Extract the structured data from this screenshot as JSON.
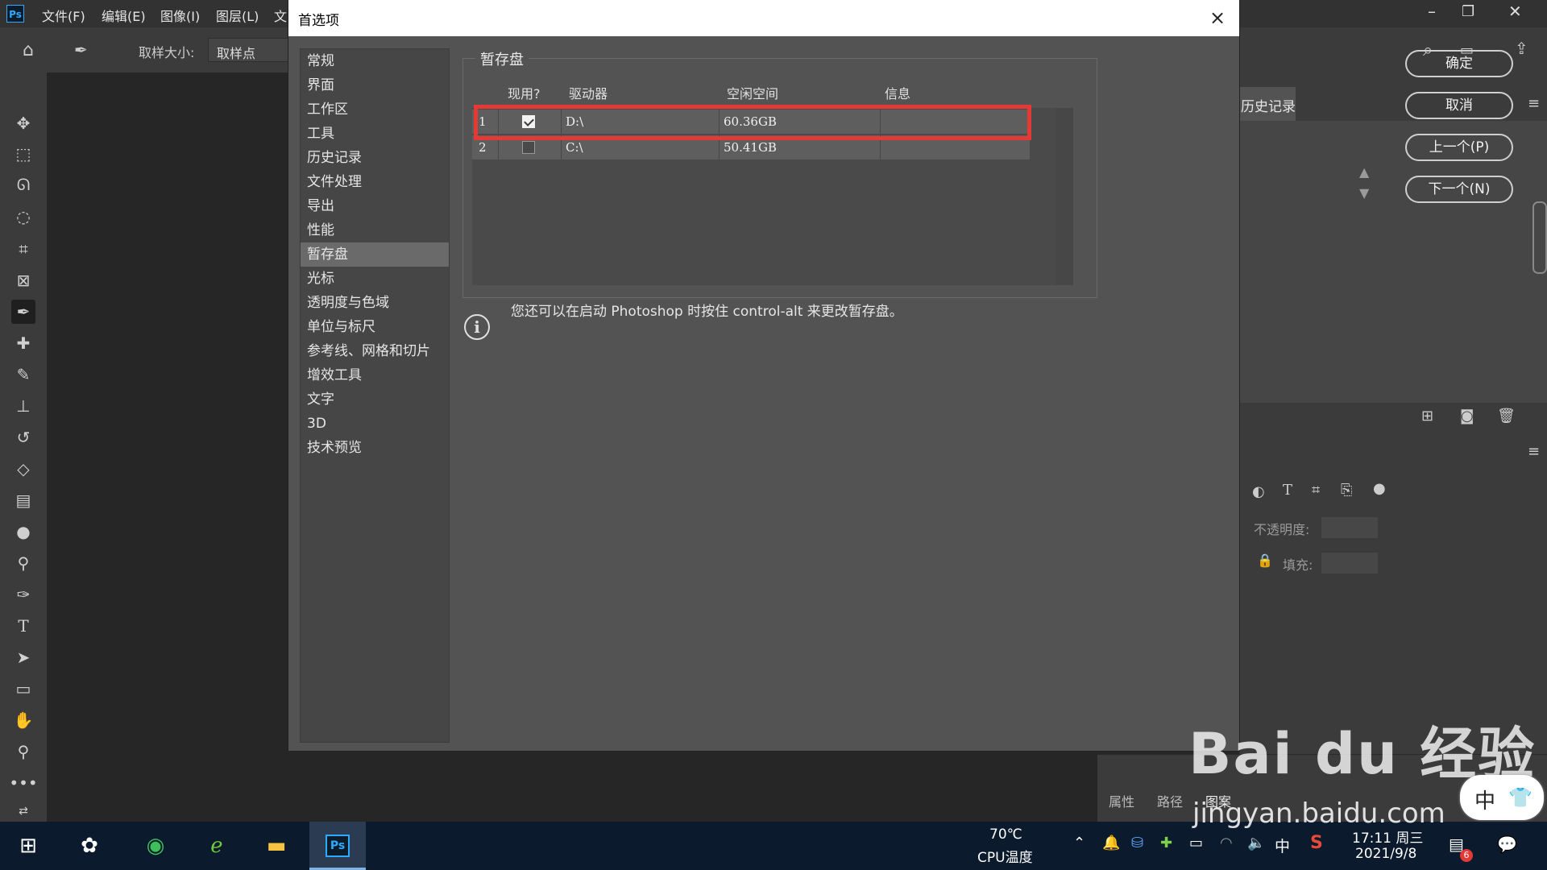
{
  "app": {
    "logo": "Ps",
    "menu": [
      "文件(F)",
      "编辑(E)",
      "图像(I)",
      "图层(L)",
      "文"
    ]
  },
  "options_bar": {
    "sample_size_label": "取样大小:",
    "sample_size_value": "取样点"
  },
  "right_panel": {
    "history_tab": "历史记录",
    "opacity_label": "不透明度:",
    "fill_label": "填充:",
    "bottom_tabs": [
      "属性",
      "路径",
      "图案"
    ]
  },
  "dialog": {
    "title": "首选项",
    "close": "×",
    "nav": [
      "常规",
      "界面",
      "工作区",
      "工具",
      "历史记录",
      "文件处理",
      "导出",
      "性能",
      "暂存盘",
      "光标",
      "透明度与色域",
      "单位与标尺",
      "参考线、网格和切片",
      "增效工具",
      "文字",
      "3D",
      "技术预览"
    ],
    "selected_nav": "暂存盘",
    "group_title": "暂存盘",
    "columns": [
      "现用?",
      "驱动器",
      "空闲空间",
      "信息"
    ],
    "rows": [
      {
        "index": "1",
        "active": true,
        "drive": "D:\\",
        "free": "60.36GB",
        "info": ""
      },
      {
        "index": "2",
        "active": false,
        "drive": "C:\\",
        "free": "50.41GB",
        "info": ""
      }
    ],
    "buttons": {
      "ok": "确定",
      "cancel": "取消",
      "prev": "上一个(P)",
      "next": "下一个(N)"
    },
    "info_text": "您还可以在启动 Photoshop 时按住 control-alt 来更改暂存盘。"
  },
  "taskbar": {
    "temp": "70℃",
    "temp_label": "CPU温度",
    "ime": "中",
    "time": "17:11 周三",
    "date": "2021/9/8",
    "badge": "6"
  },
  "watermark": {
    "main": "Bai du 经验",
    "sub": "jingyan.baidu.com",
    "ime_badge": "中"
  },
  "colors": {
    "highlight": "#e53935",
    "ps_blue": "#31a8ff"
  }
}
